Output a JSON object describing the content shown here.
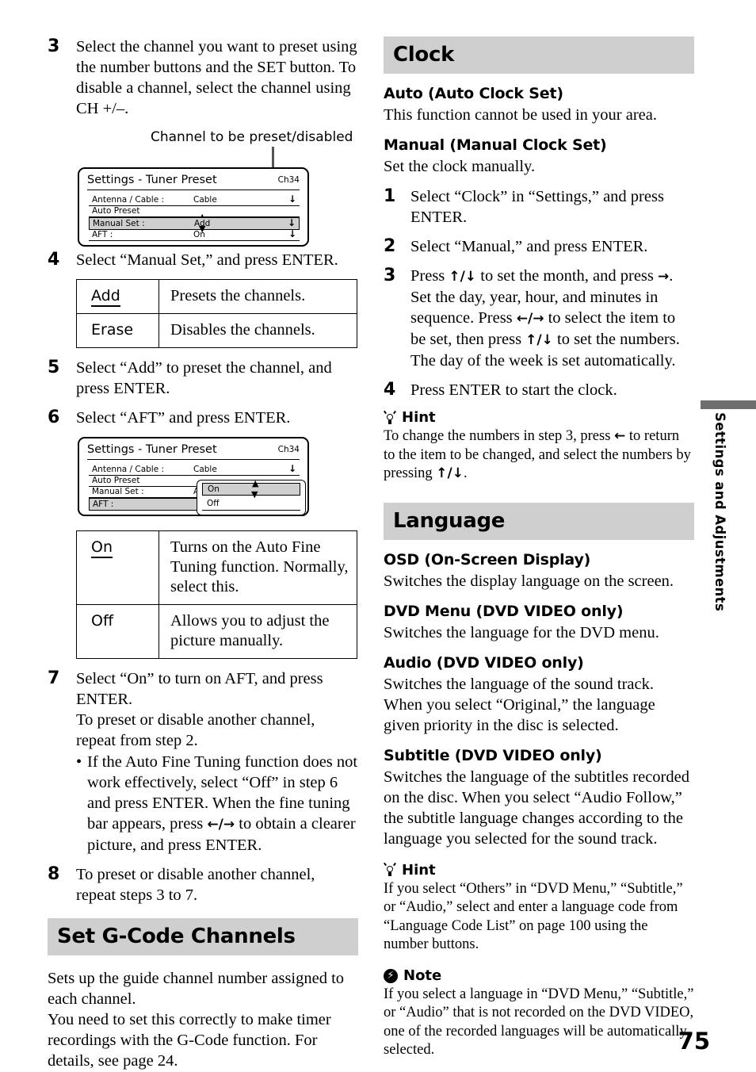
{
  "page_number": "75",
  "side_tab": {
    "label": "Settings and Adjustments"
  },
  "left_column": {
    "step3": {
      "num": "3",
      "text": "Select the channel you want to preset using the number buttons and the SET button. To disable a channel, select the channel using CH +/–."
    },
    "callout1": "Channel to be preset/disabled",
    "screen1": {
      "title": "Settings - Tuner Preset",
      "channel": "Ch34",
      "rows": [
        {
          "label": "Antenna / Cable :",
          "value": "Cable",
          "arrow": "↓"
        },
        {
          "label": "Auto Preset",
          "value": "",
          "arrow": ""
        },
        {
          "label": "Manual Set :",
          "value": "Add",
          "arrow": "↓"
        },
        {
          "label": "AFT :",
          "value": "On",
          "arrow": "↓"
        }
      ],
      "highlighted_row": "Manual Set :"
    },
    "step4": {
      "num": "4",
      "text": "Select “Manual Set,” and press ENTER."
    },
    "table_manual_set": {
      "rows": [
        {
          "key": "Add",
          "underlined": true,
          "desc": "Presets the channels."
        },
        {
          "key": "Erase",
          "underlined": false,
          "desc": "Disables the channels."
        }
      ]
    },
    "step5": {
      "num": "5",
      "text": "Select “Add” to preset the channel, and press ENTER."
    },
    "step6": {
      "num": "6",
      "text": "Select “AFT” and press ENTER."
    },
    "screen2": {
      "title": "Settings - Tuner Preset",
      "channel": "Ch34",
      "rows": [
        {
          "label": "Antenna / Cable :",
          "value": "Cable",
          "arrow": "↓"
        },
        {
          "label": "Auto Preset",
          "value": "",
          "arrow": ""
        },
        {
          "label": "Manual Set :",
          "value": "Add",
          "arrow": "↓"
        },
        {
          "label": "AFT :",
          "value": "",
          "arrow": ""
        }
      ],
      "highlighted_row": "AFT :",
      "popup": {
        "options": [
          "On",
          "Off"
        ],
        "selected": "On"
      }
    },
    "table_aft": {
      "rows": [
        {
          "key": "On",
          "underlined": true,
          "desc": "Turns on the Auto Fine Tuning function. Normally, select this."
        },
        {
          "key": "Off",
          "underlined": false,
          "desc": "Allows you to adjust the picture manually."
        }
      ]
    },
    "step7": {
      "num": "7",
      "line1": "Select “On” to turn on AFT, and press ENTER.",
      "line2": "To preset or disable another channel, repeat from step 2.",
      "bullet_a": "If the Auto Fine Tuning function does not work effectively, select “Off” in step 6 and press ENTER. When the fine tuning bar appears, press ",
      "bullet_arrows": "←/→",
      "bullet_b": " to obtain a clearer picture, and press ENTER."
    },
    "step8": {
      "num": "8",
      "text": "To preset or disable another channel, repeat steps 3 to 7."
    },
    "gcode": {
      "heading": "Set G-Code Channels",
      "para1": "Sets up the guide channel number assigned to each channel.",
      "para2": "You need to set this correctly to make timer recordings with the G-Code function. For details, see page 24."
    }
  },
  "right_column": {
    "clock": {
      "heading": "Clock",
      "auto": {
        "subhead": "Auto (Auto Clock Set)",
        "text": "This function cannot be used in your area."
      },
      "manual": {
        "subhead": "Manual (Manual Clock Set)",
        "text": "Set the clock manually."
      },
      "step1": {
        "num": "1",
        "text": "Select “Clock” in “Settings,” and press ENTER."
      },
      "step2": {
        "num": "2",
        "text": "Select “Manual,” and press ENTER."
      },
      "step3": {
        "num": "3",
        "a": "Press ",
        "arrows_ud": "↑/↓",
        "b": " to set the month, and press ",
        "arrow_r": "→",
        "c": ". Set the day, year, hour, and minutes in sequence. Press ",
        "arrows_lr": "←/→",
        "d": " to select the item to be set, then press ",
        "arrows_ud2": "↑/↓",
        "e": " to set the numbers. The day of the week is set automatically."
      },
      "step4": {
        "num": "4",
        "text": "Press ENTER to start the clock."
      },
      "hint": {
        "label": "Hint",
        "a": "To change the numbers in step 3, press ",
        "arrow_l": "←",
        "b": " to return to the item to be changed, and select the numbers by pressing ",
        "arrows_ud": "↑/↓",
        "c": "."
      }
    },
    "language": {
      "heading": "Language",
      "osd": {
        "subhead": "OSD (On-Screen Display)",
        "text": "Switches the display language on the screen."
      },
      "dvd_menu": {
        "subhead": "DVD Menu (DVD VIDEO only)",
        "text": "Switches the language for the DVD menu."
      },
      "audio": {
        "subhead": "Audio (DVD VIDEO only)",
        "text": "Switches the language of the sound track. When you select “Original,” the language given priority in the disc is selected."
      },
      "subtitle": {
        "subhead": "Subtitle (DVD VIDEO only)",
        "text": "Switches the language of the subtitles recorded on the disc. When you select “Audio Follow,” the subtitle language changes according to the language you selected for the sound track."
      },
      "hint": {
        "label": "Hint",
        "text": "If you select “Others” in “DVD Menu,” “Subtitle,” or “Audio,” select and enter a language code from “Language Code List” on page 100 using the number buttons."
      },
      "note": {
        "label": "Note",
        "text": "If you select a language in “DVD Menu,” “Subtitle,” or “Audio” that is not recorded on the DVD VIDEO, one of the recorded languages will be automatically selected."
      }
    }
  }
}
